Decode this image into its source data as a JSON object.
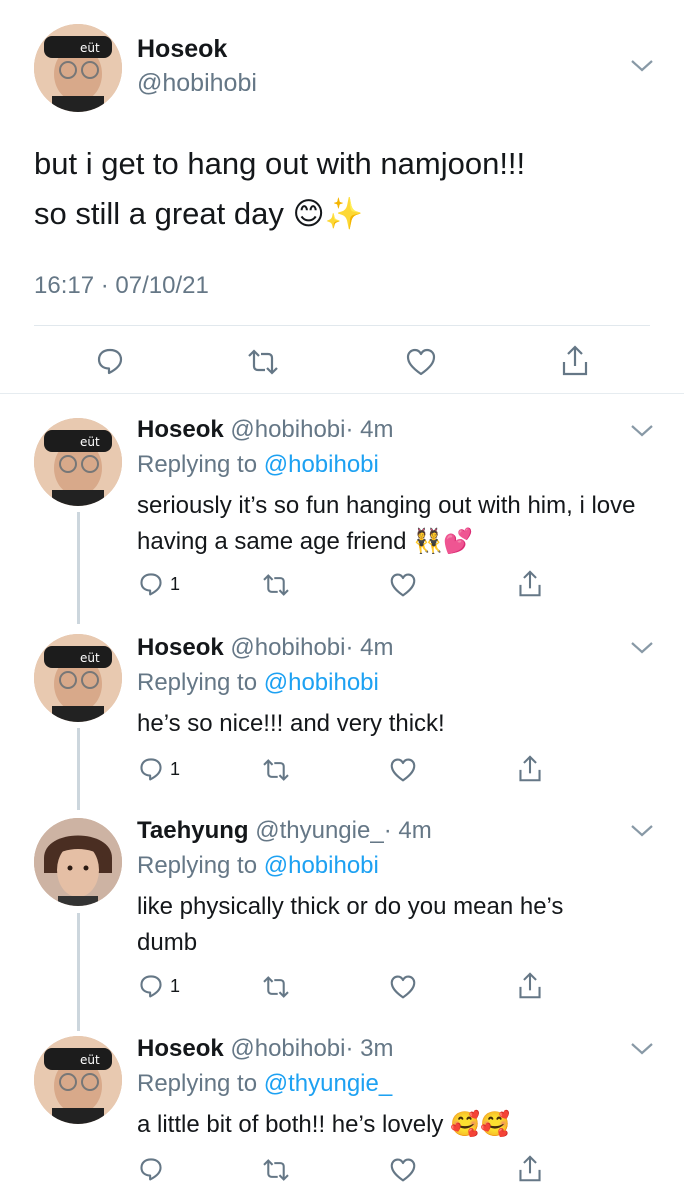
{
  "main_tweet": {
    "author_name": "Hoseok",
    "author_handle": "@hobihobi",
    "text_line1": "but i get to hang out with namjoon!!!",
    "text_line2": "so still a great day",
    "emoji": "😊✨",
    "timestamp": "16:17 · 07/10/21",
    "actions": [
      "reply-icon",
      "retweet-icon",
      "like-icon",
      "share-icon"
    ]
  },
  "replies": [
    {
      "author_name": "Hoseok",
      "author_handle": "@hobihobi",
      "time": "· 4m",
      "replying_label": "Replying to",
      "replying_to": "@hobihobi",
      "text": "seriously it’s so fun hanging out with him, i love having a same age friend 👯💕",
      "reply_count": "1"
    },
    {
      "author_name": "Hoseok",
      "author_handle": "@hobihobi",
      "time": "· 4m",
      "replying_label": "Replying to",
      "replying_to": "@hobihobi",
      "text": "he’s so nice!!! and very thick!",
      "reply_count": "1"
    },
    {
      "author_name": "Taehyung",
      "author_handle": "@thyungie_",
      "time": "· 4m",
      "replying_label": "Replying to",
      "replying_to": "@hobihobi",
      "text": "like physically thick or do you mean he’s dumb",
      "reply_count": "1"
    },
    {
      "author_name": "Hoseok",
      "author_handle": "@hobihobi",
      "time": "· 3m",
      "replying_label": "Replying to",
      "replying_to": "@thyungie_",
      "text": "a little bit of both!! he’s lovely 🥰🥰",
      "reply_count": ""
    }
  ],
  "colors": {
    "link": "#1da1f2",
    "muted": "#657786",
    "divider": "#e1e8ed",
    "thread_line": "#ccd6dd"
  }
}
